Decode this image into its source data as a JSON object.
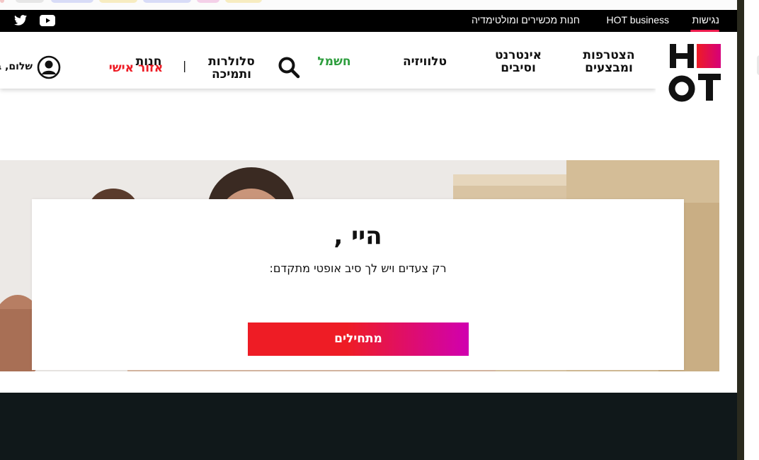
{
  "topbar": {
    "links": [
      {
        "label": "נגישות"
      },
      {
        "label": "HOT business"
      },
      {
        "label": "חנות מכשירים ומולטימדיה"
      }
    ]
  },
  "icons": {
    "youtube": "youtube-icon",
    "twitter": "twitter-icon",
    "search": "search-icon",
    "user": "user-circle-icon"
  },
  "logo": {
    "text_top": "H",
    "text_bottom": "OT"
  },
  "nav": {
    "items": [
      {
        "line1": "הצטרפות",
        "line2": "ומבצעים"
      },
      {
        "line1": "אינטרנט",
        "line2": "וסיבים"
      },
      {
        "line1": "טלוויזיה",
        "line2": ""
      },
      {
        "line1": "חשמל",
        "line2": ""
      }
    ],
    "support": {
      "line1": "סלולרות",
      "line2": "ותמיכה"
    },
    "store": "חנות",
    "personal_area": "אזור אישי",
    "divider": "|",
    "greeting": "שלום, ב"
  },
  "card": {
    "title": "היי ,",
    "subtitle": "רק צעדים ויש לך סיב אופטי מתקדם:",
    "button": "מתחילים"
  },
  "colors": {
    "brand_red": "#ee1c25",
    "brand_magenta": "#d000b0",
    "green": "#2e9e3e",
    "active_underline": "#ee1c4e"
  }
}
